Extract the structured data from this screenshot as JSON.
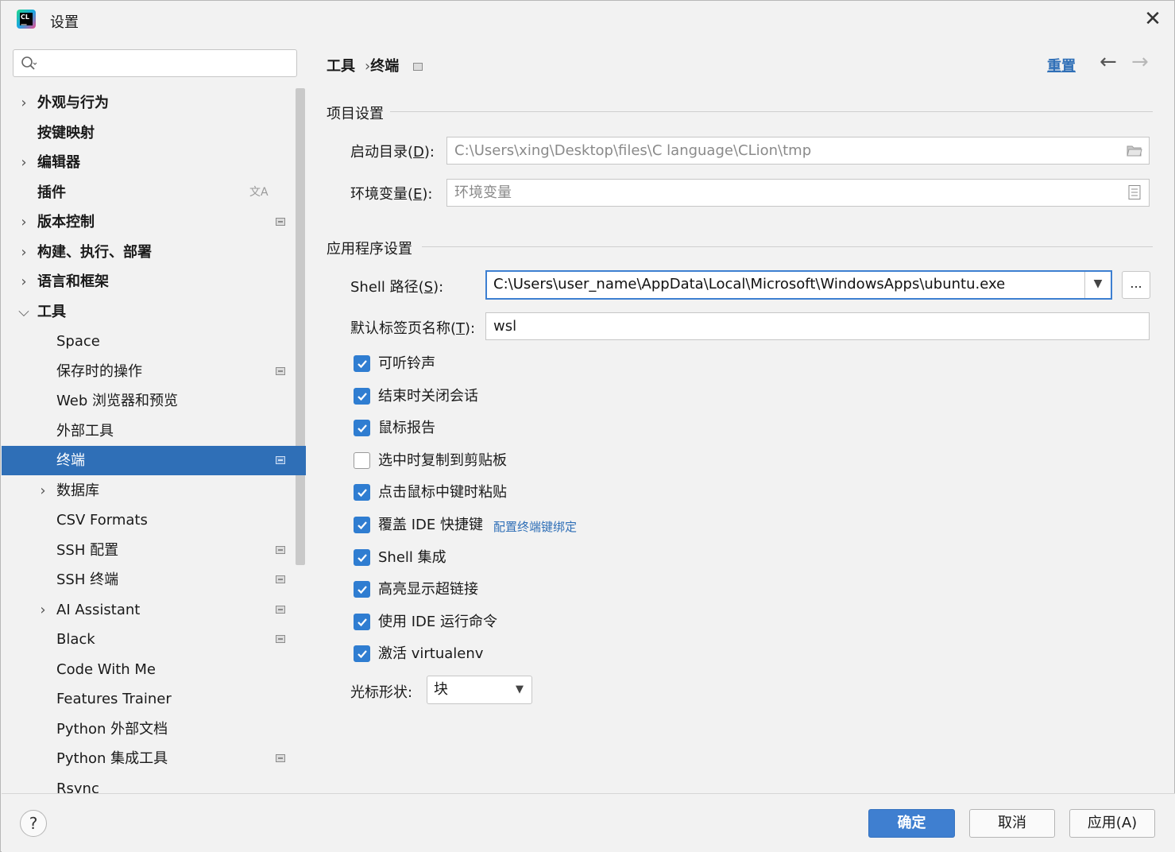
{
  "window": {
    "title": "设置"
  },
  "search": {
    "placeholder": ""
  },
  "sidebar": {
    "items": [
      {
        "label": "外观与行为",
        "bold": true,
        "expandable": true,
        "expanded": false,
        "indent": 0,
        "badge": false
      },
      {
        "label": "按键映射",
        "bold": true,
        "expandable": false,
        "indent": 0,
        "badge": false
      },
      {
        "label": "编辑器",
        "bold": true,
        "expandable": true,
        "expanded": false,
        "indent": 0,
        "badge": false
      },
      {
        "label": "插件",
        "bold": true,
        "expandable": false,
        "indent": 0,
        "badge": false,
        "translate_icon": true
      },
      {
        "label": "版本控制",
        "bold": true,
        "expandable": true,
        "expanded": false,
        "indent": 0,
        "badge": true
      },
      {
        "label": "构建、执行、部署",
        "bold": true,
        "expandable": true,
        "expanded": false,
        "indent": 0,
        "badge": false
      },
      {
        "label": "语言和框架",
        "bold": true,
        "expandable": true,
        "expanded": false,
        "indent": 0,
        "badge": false
      },
      {
        "label": "工具",
        "bold": true,
        "expandable": true,
        "expanded": true,
        "indent": 0,
        "badge": false
      },
      {
        "label": "Space",
        "bold": false,
        "expandable": false,
        "indent": 1,
        "badge": false
      },
      {
        "label": "保存时的操作",
        "bold": false,
        "expandable": false,
        "indent": 1,
        "badge": true
      },
      {
        "label": "Web 浏览器和预览",
        "bold": false,
        "expandable": false,
        "indent": 1,
        "badge": false
      },
      {
        "label": "外部工具",
        "bold": false,
        "expandable": false,
        "indent": 1,
        "badge": false
      },
      {
        "label": "终端",
        "bold": false,
        "expandable": false,
        "indent": 1,
        "badge": true,
        "selected": true
      },
      {
        "label": "数据库",
        "bold": false,
        "expandable": true,
        "expanded": false,
        "indent": 1,
        "badge": false
      },
      {
        "label": "CSV Formats",
        "bold": false,
        "expandable": false,
        "indent": 1,
        "badge": false
      },
      {
        "label": "SSH 配置",
        "bold": false,
        "expandable": false,
        "indent": 1,
        "badge": true
      },
      {
        "label": "SSH 终端",
        "bold": false,
        "expandable": false,
        "indent": 1,
        "badge": true
      },
      {
        "label": "AI Assistant",
        "bold": false,
        "expandable": true,
        "expanded": false,
        "indent": 1,
        "badge": true
      },
      {
        "label": "Black",
        "bold": false,
        "expandable": false,
        "indent": 1,
        "badge": true
      },
      {
        "label": "Code With Me",
        "bold": false,
        "expandable": false,
        "indent": 1,
        "badge": false
      },
      {
        "label": "Features Trainer",
        "bold": false,
        "expandable": false,
        "indent": 1,
        "badge": false
      },
      {
        "label": "Python 外部文档",
        "bold": false,
        "expandable": false,
        "indent": 1,
        "badge": false
      },
      {
        "label": "Python 集成工具",
        "bold": false,
        "expandable": false,
        "indent": 1,
        "badge": true
      },
      {
        "label": "Rsync",
        "bold": false,
        "expandable": false,
        "indent": 1,
        "badge": false
      }
    ]
  },
  "header": {
    "crumb_1": "工具",
    "crumb_sep": "›",
    "crumb_2": "终端",
    "reset_label": "重置",
    "back_glyph": "←",
    "forward_glyph": "→"
  },
  "project_settings": {
    "title": "项目设置",
    "start_dir_label": "启动目录(",
    "start_dir_mnemonic": "D",
    "start_dir_label_end": "):",
    "start_dir_value": "C:\\Users\\xing\\Desktop\\files\\C language\\CLion\\tmp",
    "env_label": "环境变量(",
    "env_mnemonic": "E",
    "env_label_end": "):",
    "env_placeholder": "环境变量"
  },
  "app_settings": {
    "title": "应用程序设置",
    "shell_label": "Shell 路径(",
    "shell_mnemonic": "S",
    "shell_label_end": "):",
    "shell_value": "C:\\Users\\user_name\\AppData\\Local\\Microsoft\\WindowsApps\\ubuntu.exe",
    "ellipsis": "...",
    "tab_name_label": "默认标签页名称(",
    "tab_name_mnemonic": "T",
    "tab_name_label_end": "):",
    "tab_name_value": "wsl",
    "checkboxes": [
      {
        "label": "可听铃声",
        "checked": true
      },
      {
        "label": "结束时关闭会话",
        "checked": true
      },
      {
        "label": "鼠标报告",
        "checked": true
      },
      {
        "label": "选中时复制到剪贴板",
        "checked": false
      },
      {
        "label": "点击鼠标中键时粘贴",
        "checked": true
      },
      {
        "label": "覆盖 IDE 快捷键",
        "checked": true,
        "link": "配置终端键绑定"
      },
      {
        "label": "Shell 集成",
        "checked": true
      },
      {
        "label": "高亮显示超链接",
        "checked": true
      },
      {
        "label": "使用 IDE 运行命令",
        "checked": true
      },
      {
        "label": "激活 virtualenv",
        "checked": true
      }
    ],
    "cursor_label": "光标形状:",
    "cursor_value": "块"
  },
  "footer": {
    "help_label": "?",
    "ok_label": "确定",
    "cancel_label": "取消",
    "apply_label": "应用(A)"
  },
  "colors": {
    "accent": "#2f6fb7",
    "checkbox": "#2f7dd1",
    "primary_button": "#3f7fd0"
  }
}
